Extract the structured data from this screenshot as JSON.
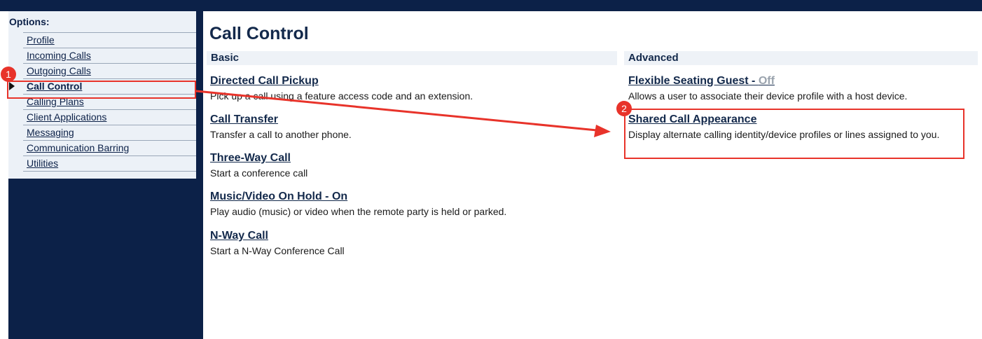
{
  "sidebar": {
    "heading": "Options:",
    "items": [
      {
        "label": "Profile"
      },
      {
        "label": "Incoming Calls"
      },
      {
        "label": "Outgoing Calls"
      },
      {
        "label": "Call Control",
        "selected": true
      },
      {
        "label": "Calling Plans"
      },
      {
        "label": "Client Applications"
      },
      {
        "label": "Messaging"
      },
      {
        "label": "Communication Barring"
      },
      {
        "label": "Utilities"
      }
    ]
  },
  "main": {
    "title": "Call Control",
    "basic": {
      "header": "Basic",
      "features": [
        {
          "name": "Directed Call Pickup",
          "desc": "Pick up a call using a feature access code and an extension."
        },
        {
          "name": "Call Transfer",
          "desc": "Transfer a call to another phone."
        },
        {
          "name": "Three-Way Call",
          "desc": "Start a conference call"
        },
        {
          "name": "Music/Video On Hold - On",
          "desc": "Play audio (music) or video when the remote party is held or parked."
        },
        {
          "name": "N-Way Call",
          "desc": "Start a N-Way Conference Call"
        }
      ]
    },
    "advanced": {
      "header": "Advanced",
      "features": [
        {
          "name": "Flexible Seating Guest - ",
          "status": "Off",
          "desc": "Allows a user to associate their device profile with a host device."
        },
        {
          "name": "Shared Call Appearance",
          "desc": "Display alternate calling identity/device profiles or lines assigned to you."
        }
      ]
    }
  },
  "annotations": {
    "step1": "1",
    "step2": "2",
    "color": "#e8332a"
  },
  "colors": {
    "navy": "#0c2148",
    "panel": "#ecf1f7",
    "header_bg": "#eef2f7",
    "off_status": "#9aa3ad"
  }
}
